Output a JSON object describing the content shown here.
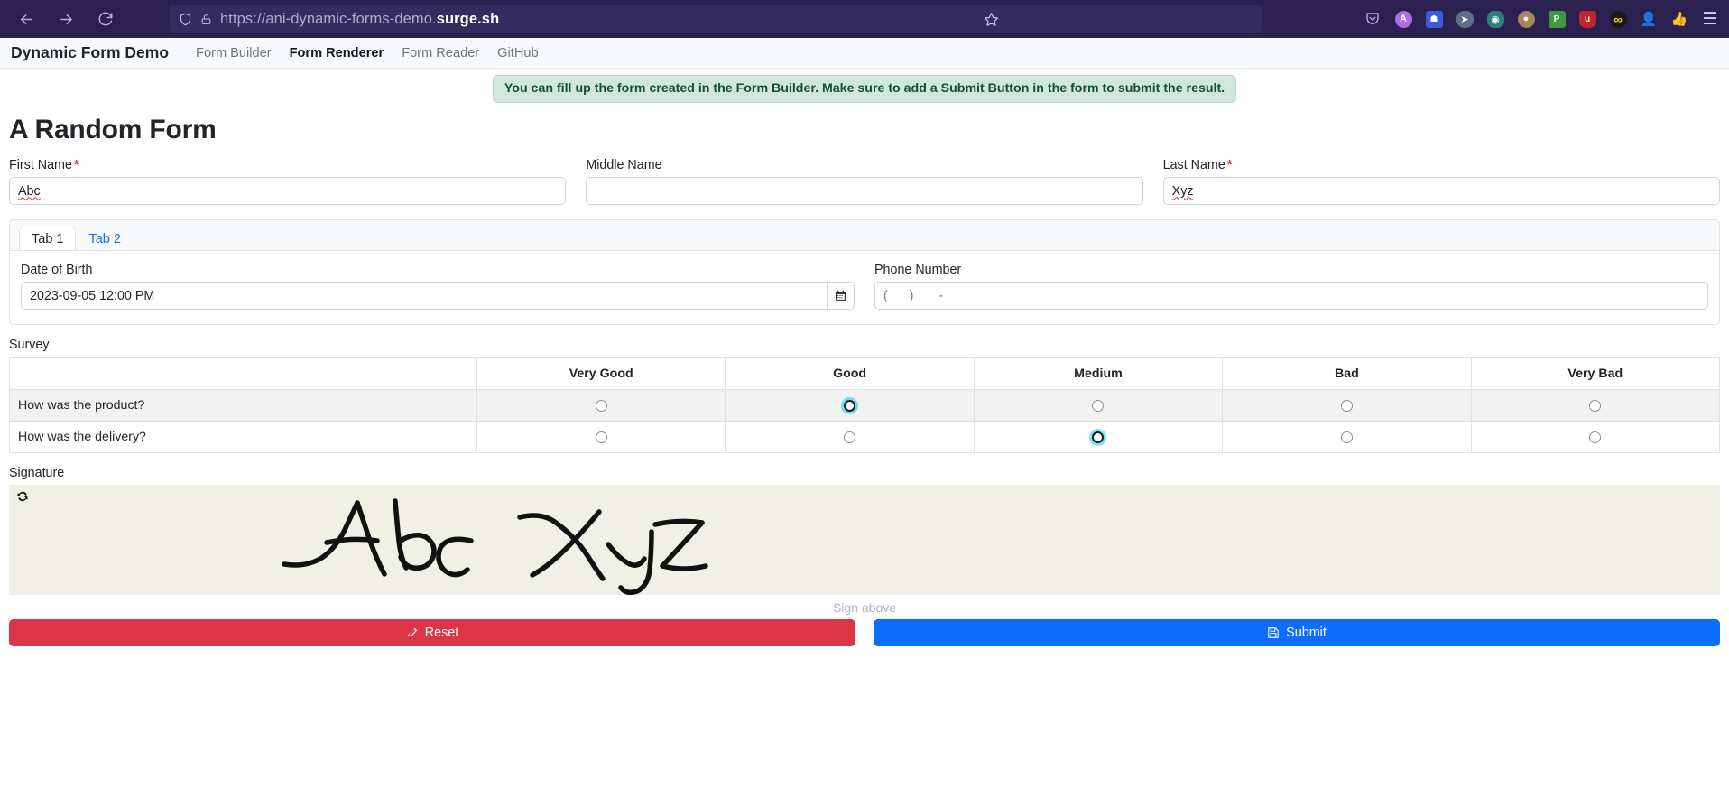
{
  "browser": {
    "url_prefix": "https://ani-dynamic-forms-demo.",
    "url_domain": "surge.sh",
    "back_icon": "back-arrow-icon",
    "forward_icon": "forward-arrow-icon",
    "reload_icon": "reload-icon",
    "shield_icon": "shield-icon",
    "lock_icon": "lock-icon",
    "bookmark_icon": "star-icon",
    "menu_icon": "hamburger-menu-icon",
    "extensions": [
      {
        "name": "pocket-extension-icon",
        "glyph": "♡",
        "bg": "transparent",
        "fg": "#b9a7ef"
      },
      {
        "name": "adblock-extension-icon",
        "glyph": "A",
        "bg": "#b06ce0",
        "fg": "#ffffff"
      },
      {
        "name": "bitwarden-extension-icon",
        "glyph": "▯",
        "bg": "#3b5bdb",
        "fg": "#ffffff"
      },
      {
        "name": "cursor-extension-icon",
        "glyph": "➤",
        "bg": "#5b6f86",
        "fg": "#ffffff"
      },
      {
        "name": "privacy-badger-extension-icon",
        "glyph": "◉",
        "bg": "#2f7f7a",
        "fg": "#ffffff"
      },
      {
        "name": "cookie-extension-icon",
        "glyph": "●",
        "bg": "#a9855c",
        "fg": "#ffffff"
      },
      {
        "name": "pdf-extension-icon",
        "glyph": "P",
        "bg": "#3f9a3f",
        "fg": "#ffffff"
      },
      {
        "name": "ublock-extension-icon",
        "glyph": "u",
        "bg": "#c0272d",
        "fg": "#ffffff"
      },
      {
        "name": "infinity-extension-icon",
        "glyph": "∞",
        "bg": "#1a1a1a",
        "fg": "#ffd43b"
      },
      {
        "name": "account-extension-icon",
        "glyph": "✓",
        "bg": "transparent",
        "fg": "#e8a33d"
      },
      {
        "name": "thumbs-up-extension-icon",
        "glyph": "✋",
        "bg": "transparent",
        "fg": "#cfc7ee"
      }
    ]
  },
  "app_nav": {
    "brand": "Dynamic Form Demo",
    "links": [
      {
        "label": "Form Builder",
        "active": false
      },
      {
        "label": "Form Renderer",
        "active": true
      },
      {
        "label": "Form Reader",
        "active": false
      },
      {
        "label": "GitHub",
        "active": false
      }
    ]
  },
  "alert": {
    "message": "You can fill up the form created in the Form Builder. Make sure to add a Submit Button in the form to submit the result.",
    "bg_color": "#d1e7dd",
    "text_color": "#0f5132"
  },
  "form": {
    "title": "A Random Form",
    "name_fields": [
      {
        "label": "First Name",
        "required": true,
        "value": "Abc",
        "placeholder": "",
        "spellcheck_error": true
      },
      {
        "label": "Middle Name",
        "required": false,
        "value": "",
        "placeholder": "",
        "spellcheck_error": false
      },
      {
        "label": "Last Name",
        "required": true,
        "value": "Xyz",
        "placeholder": "",
        "spellcheck_error": true
      }
    ],
    "tabs": [
      {
        "label": "Tab 1",
        "active": true
      },
      {
        "label": "Tab 2",
        "active": false
      }
    ],
    "dob": {
      "label": "Date of Birth",
      "value": "2023-09-05 12:00 PM",
      "calendar_icon": "calendar-icon"
    },
    "phone": {
      "label": "Phone Number",
      "value": "",
      "placeholder": "(___) ___-____"
    },
    "survey": {
      "label": "Survey",
      "columns": [
        "",
        "Very Good",
        "Good",
        "Medium",
        "Bad",
        "Very Bad"
      ],
      "rows": [
        {
          "question": "How was the product?",
          "selected": "Good"
        },
        {
          "question": "How was the delivery?",
          "selected": "Medium"
        }
      ],
      "selected_ring_color": "#0dcaf0"
    },
    "signature": {
      "label": "Signature",
      "refresh_icon": "refresh-icon",
      "hint": "Sign above",
      "pad_color": "#f0f0e6",
      "ink_text": "Abc Xyz"
    },
    "buttons": [
      {
        "label": "Reset",
        "icon": "eraser-icon",
        "color": "#dc3545"
      },
      {
        "label": "Submit",
        "icon": "save-icon",
        "color": "#0d6efd"
      }
    ]
  }
}
